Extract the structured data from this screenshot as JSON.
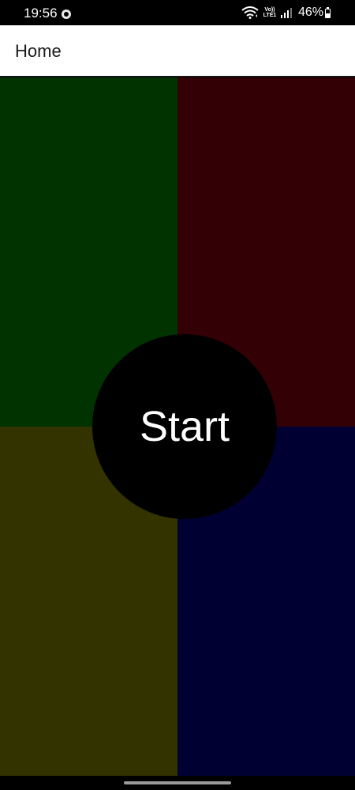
{
  "status_bar": {
    "time": "19:56",
    "lte_label": "Vo)) LTE1",
    "battery_percent": "46%",
    "battery_level": 0.46,
    "icons": [
      "notification-icon",
      "wifi-icon",
      "lte-icon",
      "signal-icon",
      "battery-icon"
    ]
  },
  "app_bar": {
    "title": "Home"
  },
  "quadrants": {
    "top_left": {
      "color": "#003300"
    },
    "top_right": {
      "color": "#330005"
    },
    "bottom_left": {
      "color": "#333300"
    },
    "bottom_right": {
      "color": "#000033"
    }
  },
  "start_button": {
    "label": "Start",
    "color": "#000000",
    "text_color": "#ffffff"
  },
  "nav_bar": {
    "icons": [
      "home-indicator"
    ]
  }
}
